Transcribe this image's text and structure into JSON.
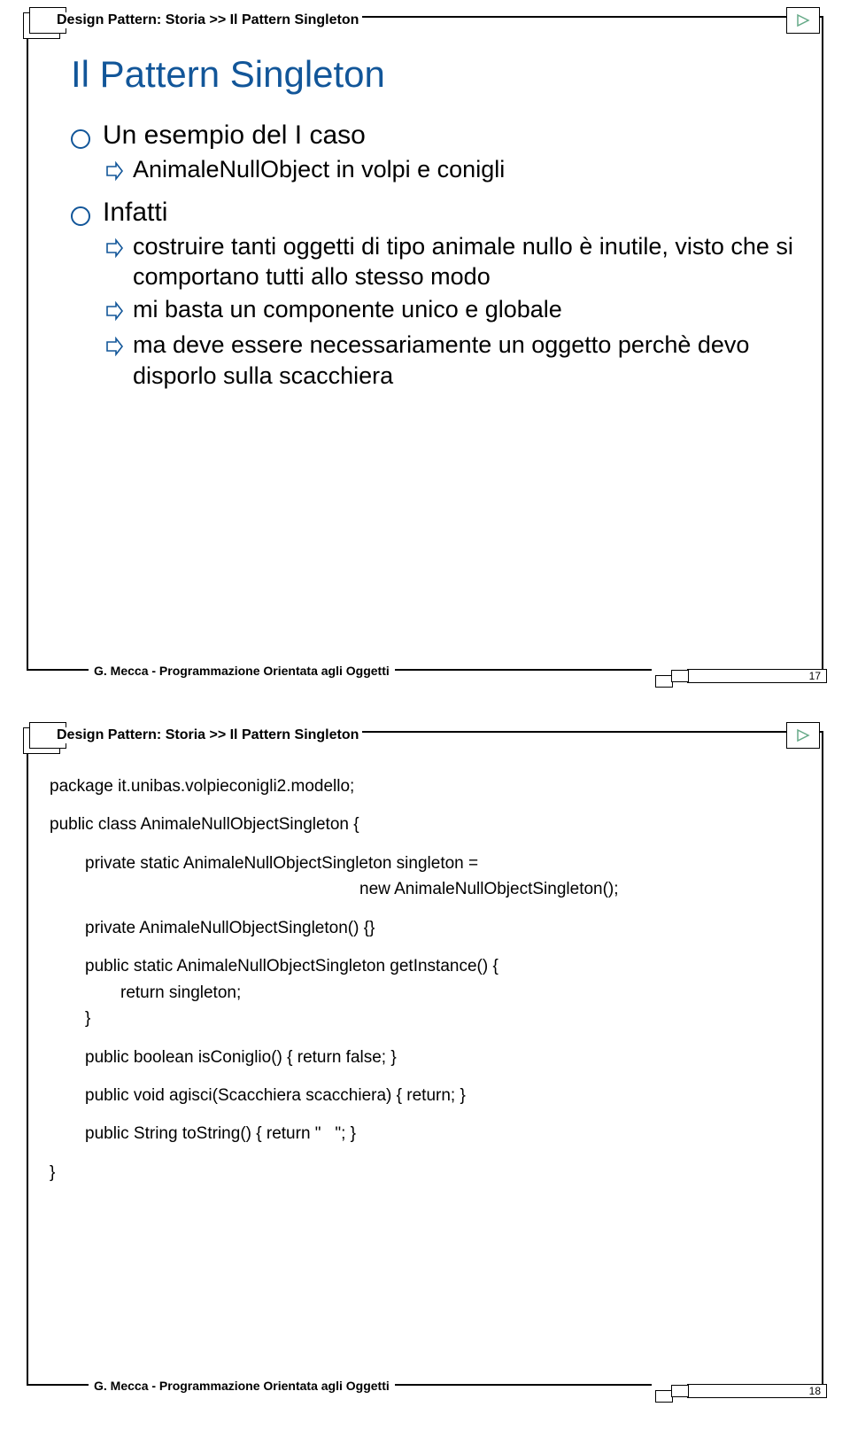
{
  "slide1": {
    "breadcrumb": "Design Pattern: Storia >> Il Pattern Singleton",
    "title": "Il Pattern Singleton",
    "bullets": {
      "b1": "Un esempio del I caso",
      "b1_1": "AnimaleNullObject in volpi e conigli",
      "b2": "Infatti",
      "b2_1": "costruire tanti oggetti di tipo animale nullo è inutile, visto che si comportano tutti allo stesso modo",
      "b2_2": "mi basta un componente unico e globale",
      "b2_3": "ma deve essere necessariamente un oggetto perchè devo disporlo sulla scacchiera"
    },
    "footer": "G. Mecca - Programmazione Orientata agli Oggetti",
    "page_number": "17"
  },
  "slide2": {
    "breadcrumb": "Design Pattern: Storia >> Il Pattern Singleton",
    "code": {
      "l1": "package it.unibas.volpieconigli2.modello;",
      "l2": "public class AnimaleNullObjectSingleton {",
      "l3": "private static AnimaleNullObjectSingleton singleton =",
      "l4": "new AnimaleNullObjectSingleton();",
      "l5": "private AnimaleNullObjectSingleton() {}",
      "l6": "public static AnimaleNullObjectSingleton getInstance() {",
      "l7": "return singleton;",
      "l8": "}",
      "l9": "public boolean isConiglio() { return false; }",
      "l10": "public void agisci(Scacchiera scacchiera) { return; }",
      "l11": "public String toString() { return \"   \"; }",
      "l12": "}"
    },
    "footer": "G. Mecca - Programmazione Orientata agli Oggetti",
    "page_number": "18"
  }
}
